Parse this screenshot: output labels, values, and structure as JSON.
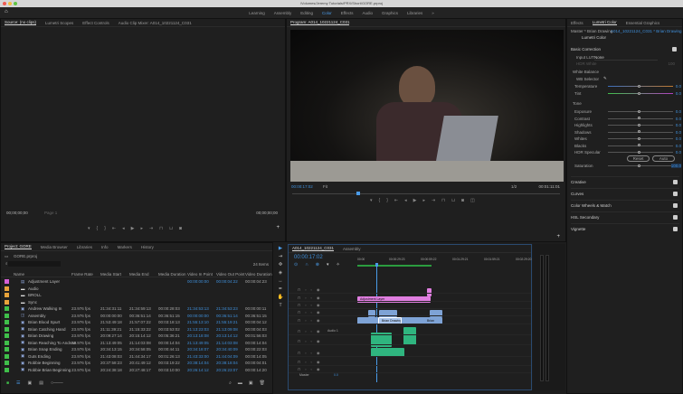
{
  "window": {
    "title": "/Volumes/Jeremy Tutorials/PRX/Short/GORE.prproj"
  },
  "workspaces": [
    "Learning",
    "Assembly",
    "Editing",
    "Color",
    "Effects",
    "Audio",
    "Graphics",
    "Libraries",
    "»"
  ],
  "active_workspace": "Color",
  "source": {
    "tabs": [
      "Source: (no clips)",
      "Lumetri Scopes",
      "Effect Controls",
      "Audio Clip Mixer: A014_10221124_C031"
    ],
    "tc_in": "00;00;00;00",
    "page": "Page 1",
    "tc_out": "00;00;00;00"
  },
  "program": {
    "tab": "Program: A014_10221124_C031",
    "timecode": "00:00:17:02",
    "fit": "Fit",
    "resolution": "1/2",
    "duration": "00:01:11:01",
    "playhead_fraction": 0.24
  },
  "lumetri": {
    "tabs": [
      "Effects",
      "Lumetri Color",
      "Essential Graphics"
    ],
    "master": "Master * Brian Drawing",
    "clip": "A014_10221124_C031 * Brian Drawing",
    "effect": "Lumetri Color",
    "basic": "Basic Correction",
    "input_lut_label": "Input LUT",
    "input_lut": "None",
    "hdr_white": "HDR White",
    "hdr_white_val": "100",
    "white_balance": "White Balance",
    "wb_selector": "WB Selector",
    "wb": [
      {
        "label": "Temperature",
        "value": "0.0"
      },
      {
        "label": "Tint",
        "value": "0.0"
      }
    ],
    "tone": "Tone",
    "tone_items": [
      {
        "label": "Exposure",
        "value": "0.0"
      },
      {
        "label": "Contrast",
        "value": "0.0"
      },
      {
        "label": "Highlights",
        "value": "0.0"
      },
      {
        "label": "Shadows",
        "value": "0.0"
      },
      {
        "label": "Whites",
        "value": "0.0"
      },
      {
        "label": "Blacks",
        "value": "0.0"
      },
      {
        "label": "HDR Specular",
        "value": "0.0"
      }
    ],
    "reset": "Reset",
    "auto": "Auto",
    "saturation": "Saturation",
    "saturation_val": "100.0",
    "sections": [
      "Creative",
      "Curves",
      "Color Wheels & Match",
      "HSL Secondary",
      "Vignette"
    ]
  },
  "project": {
    "tabs": [
      "Project: GORE",
      "Media Browser",
      "Libraries",
      "Info",
      "Markers",
      "History"
    ],
    "file": "GORE.prproj",
    "count": "24 Items",
    "columns": [
      "Name",
      "Frame Rate",
      "Media Start",
      "Media End",
      "Media Duration",
      "Video In Point",
      "Video Out Point",
      "Video Duration"
    ],
    "rows": [
      {
        "color": "#d55fd5",
        "type": "adj",
        "name": "Adjustment Layer",
        "cells": [
          "",
          "",
          "",
          "",
          "00:00:00:00",
          "00:00:04:22",
          "00:00:04:23"
        ]
      },
      {
        "color": "#e8a33a",
        "type": "folder",
        "name": "Audio",
        "cells": [
          "",
          "",
          "",
          "",
          "",
          "",
          ""
        ]
      },
      {
        "color": "#e8a33a",
        "type": "folder",
        "name": "BROLL",
        "cells": [
          "",
          "",
          "",
          "",
          "",
          "",
          ""
        ]
      },
      {
        "color": "#e8a33a",
        "type": "folder",
        "name": "Sync",
        "cells": [
          "",
          "",
          "",
          "",
          "",
          "",
          ""
        ]
      },
      {
        "color": "#3fbf4a",
        "type": "clip",
        "name": "Andrew Walking In",
        "cells": [
          "23.976 fps",
          "21:34:31:11",
          "21:34:59:13",
          "00:00:28:03",
          "21:34:53:13",
          "21:34:53:23",
          "00:00:00:11"
        ]
      },
      {
        "color": "#3fbf4a",
        "type": "seq",
        "name": "Assembly",
        "cells": [
          "23.976 fps",
          "00:00:00:00",
          "00:36:51:14",
          "00:36:51:15",
          "00:00:00:00",
          "00:36:51:14",
          "00:36:51:15"
        ]
      },
      {
        "color": "#3fbf4a",
        "type": "clip",
        "name": "Brian Blood Spurt",
        "cells": [
          "23.976 fps",
          "21:53:49:18",
          "21:57:07:22",
          "00:03:18:13",
          "21:55:13:10",
          "21:55:19:21",
          "00:00:04:12"
        ]
      },
      {
        "color": "#3fbf4a",
        "type": "clip",
        "name": "Brian Catching Hand",
        "cells": [
          "23.976 fps",
          "21:11:39:21",
          "21:15:33:22",
          "00:03:53:02",
          "21:13:23:03",
          "21:13:09:08",
          "00:00:04:03"
        ]
      },
      {
        "color": "#3fbf4a",
        "type": "clip",
        "name": "Brian Drawing",
        "cells": [
          "23.976 fps",
          "20:09:27:14",
          "20:15:14:12",
          "00:05:36:21",
          "20:13:18:08",
          "20:13:14:12",
          "00:01:56:03"
        ]
      },
      {
        "color": "#3fbf4a",
        "type": "clip",
        "name": "Brian Reaching To Andrew",
        "cells": [
          "23.976 fps",
          "21:13:49:05",
          "21:14:03:08",
          "00:00:14:04",
          "21:13:49:05",
          "21:14:03:08",
          "00:00:14:04"
        ]
      },
      {
        "color": "#3fbf4a",
        "type": "clip",
        "name": "Brian Snap Ending",
        "cells": [
          "23.976 fps",
          "20:34:13:15",
          "20:34:58:05",
          "00:00:44:11",
          "20:34:18:07",
          "20:34:40:09",
          "00:00:22:03"
        ]
      },
      {
        "color": "#3fbf4a",
        "type": "clip",
        "name": "Guts Ending",
        "cells": [
          "23.976 fps",
          "21:43:08:03",
          "21:44:34:17",
          "00:01:26:13",
          "21:43:33:00",
          "21:44:04:09",
          "00:00:14:05"
        ]
      },
      {
        "color": "#3fbf4a",
        "type": "clip",
        "name": "Robbie Beginning",
        "cells": [
          "23.976 fps",
          "20:37:58:23",
          "20:41:49:12",
          "00:03:19:22",
          "20:38:14:04",
          "20:38:18:04",
          "00:00:04:01"
        ]
      },
      {
        "color": "#3fbf4a",
        "type": "clip",
        "name": "Robbie Brian Beginning",
        "cells": [
          "23.976 fps",
          "20:24:38:18",
          "20:27:48:17",
          "00:03:10:00",
          "20:26:14:12",
          "20:26:23:07",
          "00:00:14:20"
        ]
      }
    ]
  },
  "timeline": {
    "tabs": [
      "A014_10221124_C031",
      "Assembly"
    ],
    "timecode": "00:00:17:02",
    "ruler": [
      "00:00",
      "00:00:29:23",
      "00:00:59:22",
      "00:01:29:21",
      "00:01:59:21",
      "00:02:29:20"
    ],
    "audio_label": "Audio 1",
    "master": "Master",
    "master_val": "0.0",
    "clips": {
      "adjustment": "Adjustment Layer",
      "brian": "Brian Drawing",
      "brian2": "Brian"
    }
  },
  "colors": {
    "accent": "#3f8ed8",
    "adjustment": "#e07ee0",
    "video": "#7ea3d6",
    "audio": "#2fb57f"
  }
}
